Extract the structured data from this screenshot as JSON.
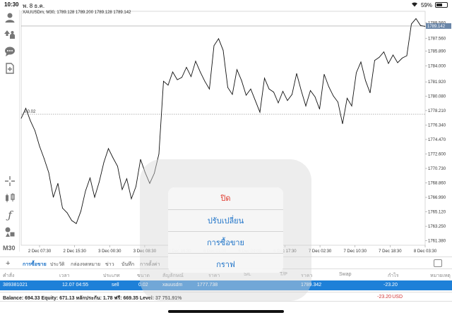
{
  "status_bar": {
    "time": "10:30",
    "date": "พ. 8 ธ.ค.",
    "battery": "59%",
    "battery_level": 0.59
  },
  "toolbar": {
    "icons": [
      "account-icon",
      "trade-icon",
      "chat-icon",
      "new-document-icon",
      "crosshair-icon",
      "indicators-icon",
      "function-icon",
      "objects-icon"
    ],
    "period": "M30"
  },
  "chart_header": "XAUUSDm, M30, 1789.128 1789.200 1789.128 1789.142",
  "chart_data": {
    "type": "line",
    "symbol": "XAUUSDm",
    "timeframe": "M30",
    "x_ticks": [
      "2 Dec 07:30",
      "2 Dec 15:30",
      "3 Dec 00:30",
      "3 Dec 08:30",
      "3 Dec 16:30",
      "6 Dec 01:00",
      "6 Dec 09:00",
      "6 Dec 17:30",
      "7 Dec 02:30",
      "7 Dec 10:30",
      "7 Dec 18:30",
      "8 Dec 03:30"
    ],
    "y_ticks": [
      1789.56,
      1787.56,
      1785.89,
      1784.0,
      1781.92,
      1780.08,
      1778.21,
      1776.34,
      1774.47,
      1772.6,
      1770.73,
      1768.86,
      1766.99,
      1765.12,
      1763.25,
      1761.38
    ],
    "ylim": [
      1760.8,
      1790.5
    ],
    "current_price": 1789.142,
    "current_price_label": "1789.142",
    "position_line": 1777.738,
    "position_label": "s 0.02",
    "values": [
      1777.2,
      1778.5,
      1776.9,
      1775.6,
      1773.6,
      1772.0,
      1770.2,
      1767.0,
      1768.8,
      1765.6,
      1765.0,
      1764.0,
      1763.6,
      1765.2,
      1767.8,
      1769.5,
      1767.0,
      1769.0,
      1771.5,
      1773.3,
      1772.1,
      1771.0,
      1768.0,
      1769.4,
      1766.8,
      1768.4,
      1771.9,
      1770.2,
      1768.8,
      1770.1,
      1772.6,
      1782.0,
      1781.5,
      1783.2,
      1782.2,
      1782.5,
      1783.8,
      1782.6,
      1784.6,
      1783.2,
      1782.0,
      1781.0,
      1786.6,
      1787.5,
      1786.0,
      1781.2,
      1780.3,
      1783.5,
      1782.1,
      1780.2,
      1781.0,
      1779.5,
      1778.0,
      1782.4,
      1781.0,
      1780.6,
      1779.2,
      1780.7,
      1779.5,
      1780.3,
      1783.0,
      1780.8,
      1778.8,
      1780.8,
      1780.0,
      1778.4,
      1782.9,
      1781.3,
      1780.1,
      1779.3,
      1776.5,
      1779.8,
      1778.8,
      1783.1,
      1784.5,
      1782.1,
      1780.5,
      1784.7,
      1785.1,
      1785.8,
      1784.3,
      1785.4,
      1784.4,
      1785.0,
      1785.3,
      1789.4,
      1790.1,
      1789.2,
      1789.1
    ]
  },
  "tabs": {
    "items": [
      "การซื้อขาย",
      "ประวัติ",
      "กล่องจดหมาย",
      "ข่าว",
      "บันทึก",
      "การตั้งค่า"
    ],
    "active": 0
  },
  "table": {
    "headers": [
      "คำสั่ง",
      "เวลา",
      "ประเภท",
      "ขนาด",
      "สัญลักษณ์",
      "ราคา",
      "S/L",
      "T/P",
      "ราคา",
      "Swap",
      "กำไร",
      "หมายเหตุ"
    ],
    "row": {
      "order": "389381021",
      "time": "12.07 04:55",
      "type": "sell",
      "size": "0.02",
      "symbol": "xauusdm",
      "open_price": "1777.738",
      "price": "1789.342",
      "profit": "-23.20"
    }
  },
  "balance_bar": {
    "text": "Balance: 694.33 Equity: 671.13 หลักประกัน: 1.78 ฟรี: 669.35 Level: 37 751.91%",
    "profit": "-23.20",
    "currency": "USD"
  },
  "action_sheet": {
    "items": [
      "ปิด",
      "ปรับเปลี่ยน",
      "การซื้อขาย",
      "กราฟ"
    ]
  },
  "colors": {
    "accent": "#1e73c8",
    "destructive": "#e03b2e",
    "loss": "#d23333",
    "selected_row": "#1e80d8"
  }
}
